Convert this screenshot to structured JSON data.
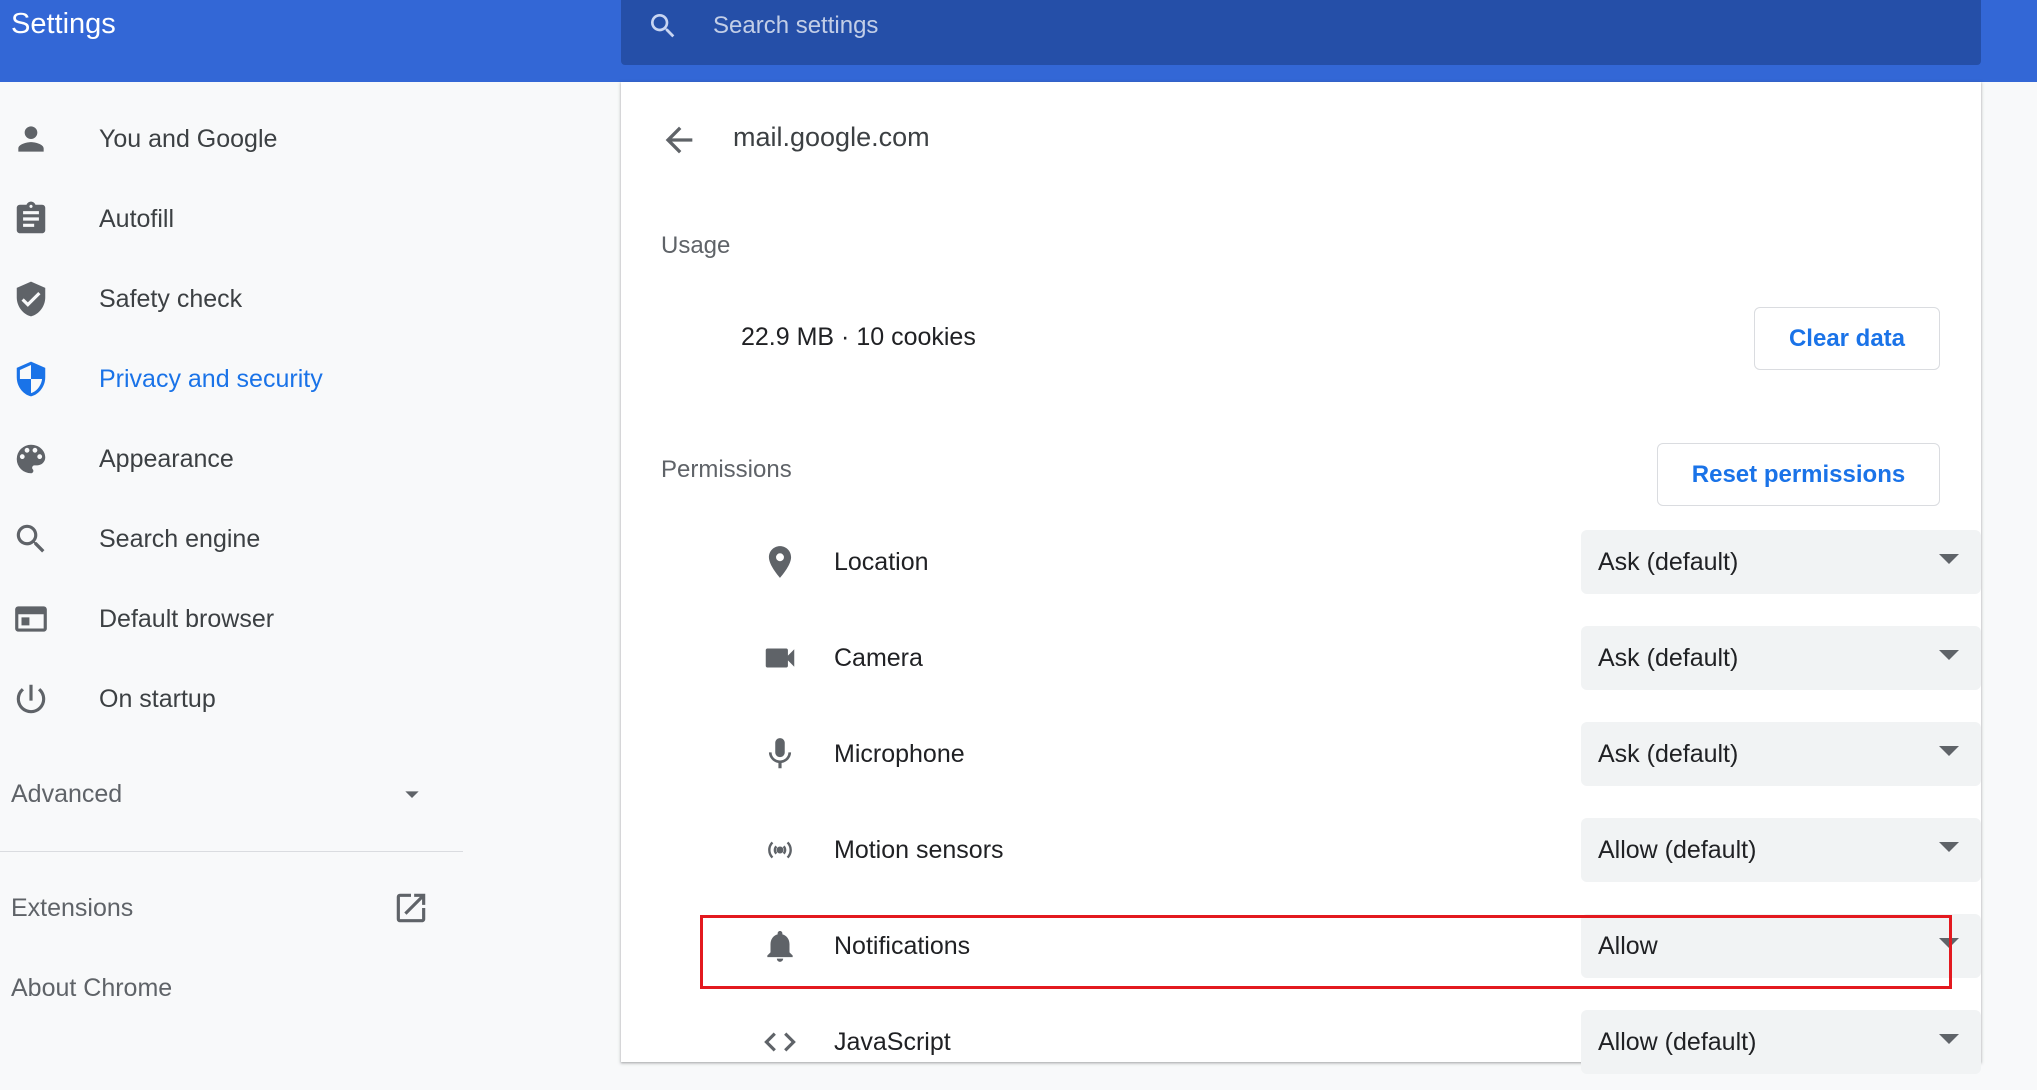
{
  "app": {
    "title": "Settings"
  },
  "search": {
    "placeholder": "Search settings"
  },
  "sidebar": {
    "items": [
      {
        "label": "You and Google",
        "icon": "person-icon"
      },
      {
        "label": "Autofill",
        "icon": "clipboard-icon"
      },
      {
        "label": "Safety check",
        "icon": "shield-check-icon"
      },
      {
        "label": "Privacy and security",
        "icon": "shield-privacy-icon",
        "active": true
      },
      {
        "label": "Appearance",
        "icon": "palette-icon"
      },
      {
        "label": "Search engine",
        "icon": "search-icon"
      },
      {
        "label": "Default browser",
        "icon": "browser-icon"
      },
      {
        "label": "On startup",
        "icon": "power-icon"
      }
    ],
    "advanced_label": "Advanced",
    "extensions_label": "Extensions",
    "about_label": "About Chrome"
  },
  "site": {
    "title": "mail.google.com",
    "usage_heading": "Usage",
    "usage_text": "22.9 MB · 10 cookies",
    "clear_data_label": "Clear data",
    "permissions_heading": "Permissions",
    "reset_permissions_label": "Reset permissions",
    "permissions": [
      {
        "label": "Location",
        "value": "Ask (default)",
        "icon": "location-pin-icon"
      },
      {
        "label": "Camera",
        "value": "Ask (default)",
        "icon": "camera-icon"
      },
      {
        "label": "Microphone",
        "value": "Ask (default)",
        "icon": "microphone-icon"
      },
      {
        "label": "Motion sensors",
        "value": "Allow (default)",
        "icon": "motion-sensor-icon"
      },
      {
        "label": "Notifications",
        "value": "Allow",
        "icon": "bell-icon",
        "highlighted": true
      },
      {
        "label": "JavaScript",
        "value": "Allow (default)",
        "icon": "code-icon"
      }
    ]
  },
  "colors": {
    "header": "#3367d6",
    "search_box": "#254fa8",
    "accent": "#1a73e8",
    "highlight": "#e3191f"
  }
}
